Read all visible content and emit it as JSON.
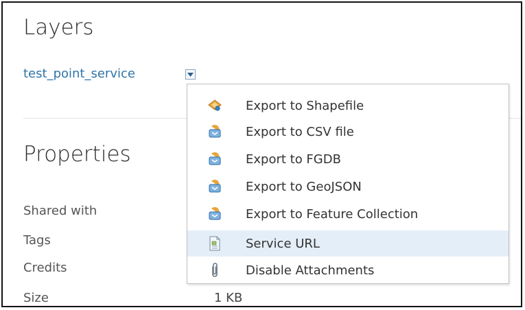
{
  "layers": {
    "heading": "Layers",
    "layer_name": "test_point_service"
  },
  "properties": {
    "heading": "Properties",
    "rows": [
      {
        "label": "Shared with",
        "value": ""
      },
      {
        "label": "Tags",
        "value": ""
      },
      {
        "label": "Credits",
        "value": ""
      },
      {
        "label": "Size",
        "value": "1 KB"
      }
    ]
  },
  "menu": {
    "items": [
      {
        "label": "Export to Shapefile",
        "icon": "shapefile-export-icon"
      },
      {
        "label": "Export to CSV file",
        "icon": "export-icon"
      },
      {
        "label": "Export to FGDB",
        "icon": "export-icon"
      },
      {
        "label": "Export to GeoJSON",
        "icon": "export-icon"
      },
      {
        "label": "Export to Feature Collection",
        "icon": "export-icon"
      },
      {
        "label": "Service URL",
        "icon": "document-icon",
        "highlighted": true
      },
      {
        "label": "Disable Attachments",
        "icon": "paperclip-icon"
      }
    ]
  },
  "colors": {
    "link": "#2f74a8",
    "menu_highlight": "#e4eef8",
    "text": "#333333"
  }
}
